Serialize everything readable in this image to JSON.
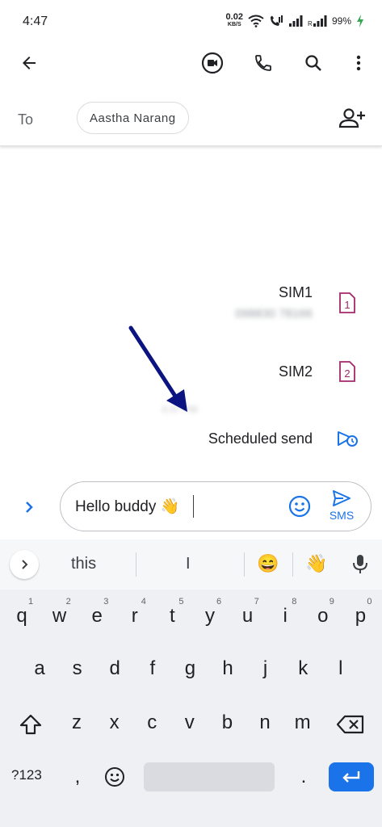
{
  "status_bar": {
    "time": "4:47",
    "net_speed_value": "0.02",
    "net_speed_unit": "KB/S",
    "battery": "99%"
  },
  "compose_header": {
    "to_label": "To",
    "recipient": "Aastha Narang"
  },
  "sim_menu": {
    "items": [
      {
        "label": "SIM1",
        "sub": "098830 78166",
        "badge": "1"
      },
      {
        "label": "SIM2",
        "badge": "2"
      },
      {
        "label": "Scheduled send"
      }
    ],
    "blurred_time": "4:47 PM"
  },
  "compose": {
    "text": "Hello buddy 👋",
    "send_label": "SMS"
  },
  "keyboard": {
    "suggestions": [
      "this",
      "I",
      "😄",
      "👋"
    ],
    "row1": [
      {
        "k": "q",
        "h": "1"
      },
      {
        "k": "w",
        "h": "2"
      },
      {
        "k": "e",
        "h": "3"
      },
      {
        "k": "r",
        "h": "4"
      },
      {
        "k": "t",
        "h": "5"
      },
      {
        "k": "y",
        "h": "6"
      },
      {
        "k": "u",
        "h": "7"
      },
      {
        "k": "i",
        "h": "8"
      },
      {
        "k": "o",
        "h": "9"
      },
      {
        "k": "p",
        "h": "0"
      }
    ],
    "row2": [
      "a",
      "s",
      "d",
      "f",
      "g",
      "h",
      "j",
      "k",
      "l"
    ],
    "row3": [
      "z",
      "x",
      "c",
      "v",
      "b",
      "n",
      "m"
    ],
    "sym_label": "?123",
    "comma": ",",
    "period": "."
  },
  "colors": {
    "accent": "#1a73e8",
    "sim_badge": "#a5276c",
    "arrow": "#0b1480"
  }
}
